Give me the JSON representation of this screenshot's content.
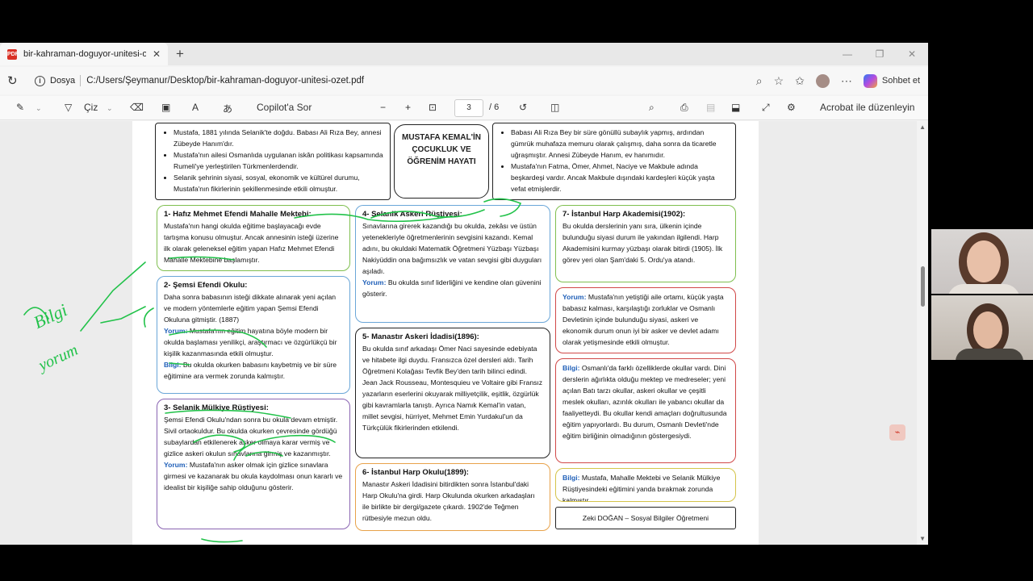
{
  "tab": {
    "title": "bir-kahraman-doguyor-unitesi-o",
    "close": "✕",
    "new": "+"
  },
  "window": {
    "minimize": "—",
    "restore": "❐",
    "close": "✕"
  },
  "address": {
    "scheme_label": "Dosya",
    "url": "C:/Users/Şeymanur/Desktop/bir-kahraman-doguyor-unitesi-ozet.pdf",
    "chat_label": "Sohbet et"
  },
  "toolbar": {
    "draw_label": "Çiz",
    "copilot_label": "Copilot'a Sor",
    "page_current": "3",
    "page_total": "/ 6",
    "acrobat_label": "Acrobat ile düzenleyin"
  },
  "pdf": {
    "title": "MUSTAFA KEMAL'İN ÇOCUKLUK VE ÖĞRENİM HAYATI",
    "top_left": [
      "Mustafa, 1881 yılında Selanik'te doğdu. Babası Ali Rıza Bey, annesi Zübeyde Hanım'dır.",
      "Mustafa'nın ailesi Osmanlıda uygulanan iskân politikası kapsamında Rumeli'ye yerleştirilen Türkmenlerdendir.",
      "Selanik şehrinin siyasi, sosyal, ekonomik ve kültürel durumu, Mustafa'nın fikirlerinin şekillenmesinde etkili olmuştur."
    ],
    "top_right": [
      "Babası Ali Rıza Bey bir süre gönüllü subaylık yapmış, ardından gümrük muhafaza memuru olarak çalışmış, daha sonra da ticaretle uğraşmıştır. Annesi Zübeyde Hanım, ev hanımıdır.",
      "Mustafa'nın Fatma, Ömer, Ahmet, Naciye ve Makbule adında beşkardeşi vardır. Ancak Makbule dışındaki kardeşleri küçük yaşta vefat etmişlerdir."
    ],
    "box1": {
      "title": "1- Hafız Mehmet Efendi Mahalle Mektebi:",
      "text": "Mustafa'nın hangi okulda eğitime başlayacağı evde tartışma konusu olmuştur. Ancak annesinin isteği üzerine ilk olarak geleneksel eğitim yapan Hafız Mehmet Efendi Mahalle Mektebine başlamıştır."
    },
    "box2": {
      "title": "2- Şemsi Efendi Okulu:",
      "text": "Daha sonra babasının isteği dikkate alınarak yeni açılan ve modern yöntemlerle eğitim yapan Şemsi Efendi Okuluna gitmiştir. (1887)",
      "yorum_label": "Yorum:",
      "yorum": "Mustafa'nın eğitim hayatına böyle modern bir okulda başlaması yenilikçi, araştırmacı ve özgürlükçü bir kişilik kazanmasında etkili olmuştur.",
      "bilgi_label": "Bilgi:",
      "bilgi": "Bu okulda okurken babasını kaybetmiş ve bir süre eğitimine ara vermek zorunda kalmıştır."
    },
    "box3": {
      "title": "3- Selanik Mülkiye Rüştiyesi:",
      "text": "Şemsi Efendi Okulu'ndan sonra bu okula devam etmiştir. Sivil ortaokuldur. Bu okulda okurken çevresinde gördüğü subaylardan etkilenerek asker olmaya karar vermiş ve gizlice askeri okulun sınavlarına girmiş ve kazanmıştır.",
      "yorum_label": "Yorum:",
      "yorum": "Mustafa'nın asker olmak için gizlice sınavlara girmesi ve kazanarak bu okula kaydolması onun kararlı ve idealist bir kişiliğe sahip olduğunu gösterir."
    },
    "box4": {
      "title": "4- Selanik Askeri Rüştiyesi:",
      "text": "Sınavlarına girerek kazandığı bu okulda, zekâsı ve üstün yetenekleriyle öğretmenlerinin sevgisini kazandı. Kemal adını, bu okuldaki Matematik Öğretmeni Yüzbaşı Yüzbaşı Nakiyüddin ona bağımsızlık ve vatan sevgisi gibi duyguları aşıladı.",
      "yorum_label": "Yorum:",
      "yorum": "Bu okulda sınıf liderliğini ve kendine olan güvenini gösterir."
    },
    "box5": {
      "title": "5- Manastır Askeri İdadisi(1896):",
      "text": "Bu okulda sınıf arkadaşı Ömer Naci sayesinde edebiyata ve hitabete ilgi duydu. Fransızca özel dersleri aldı. Tarih Öğretmeni Kolağası Tevfik Bey'den tarih bilinci edindi. Jean Jack Rousseau, Montesquieu ve Voltaire gibi Fransız yazarların eserlerini okuyarak milliyetçilik, eşitlik, özgürlük gibi kavramlarla tanıştı. Ayrıca Namık Kemal'in vatan, millet sevgisi, hürriyet, Mehmet Emin Yurdakul'un da Türkçülük fikirlerinden etkilendi."
    },
    "box6": {
      "title": "6- İstanbul Harp Okulu(1899):",
      "text": "Manastır Askeri İdadisini bitirdikten sonra İstanbul'daki Harp Okulu'na girdi. Harp Okulunda okurken arkadaşları ile birlikte bir dergi/gazete çıkardı. 1902'de Teğmen rütbesiyle mezun oldu."
    },
    "box7": {
      "title": "7- İstanbul Harp Akademisi(1902):",
      "text": "Bu okulda derslerinin yanı sıra, ülkenin içinde bulunduğu siyasi durum ile yakından ilgilendi. Harp Akademisini kurmay yüzbaşı olarak bitirdi (1905). İlk görev yeri olan Şam'daki 5. Ordu'ya atandı."
    },
    "yorum7": {
      "label": "Yorum:",
      "text": "Mustafa'nın yetiştiği aile ortamı, küçük yaşta babasız kalması, karşılaştığı zorluklar ve Osmanlı Devletinin içinde bulunduğu siyasi, askeri ve ekonomik durum onun iyi bir asker ve devlet adamı olarak yetişmesinde etkili olmuştur."
    },
    "bilgi_osm": {
      "label": "Bilgi:",
      "text": "Osmanlı'da farklı özelliklerde okullar vardı. Dini derslerin ağırlıkta olduğu mektep ve medreseler; yeni açılan Batı tarzı okullar, askeri okullar ve çeşitli meslek okulları, azınlık okulları ile yabancı okullar da faaliyetteydi. Bu okullar kendi amaçları doğrultusunda eğitim yapıyorlardı. Bu durum, Osmanlı Devleti'nde eğitim birliğinin olmadığının göstergesiydi."
    },
    "bilgi_last": {
      "label": "Bilgi:",
      "text": "Mustafa, Mahalle Mektebi ve Selanik Mülkiye Rüştiyesindeki eğitimini yanda bırakmak zorunda kalmıştır."
    },
    "author": "Zeki DOĞAN – Sosyal Bilgiler Öğretmeni"
  },
  "ink": {
    "left_note_1": "Bilgi",
    "left_note_2": "yorum"
  },
  "colors": {
    "ink": "#22c24a",
    "accent_red": "#d0202a",
    "accent_blue": "#1f5fb8"
  }
}
